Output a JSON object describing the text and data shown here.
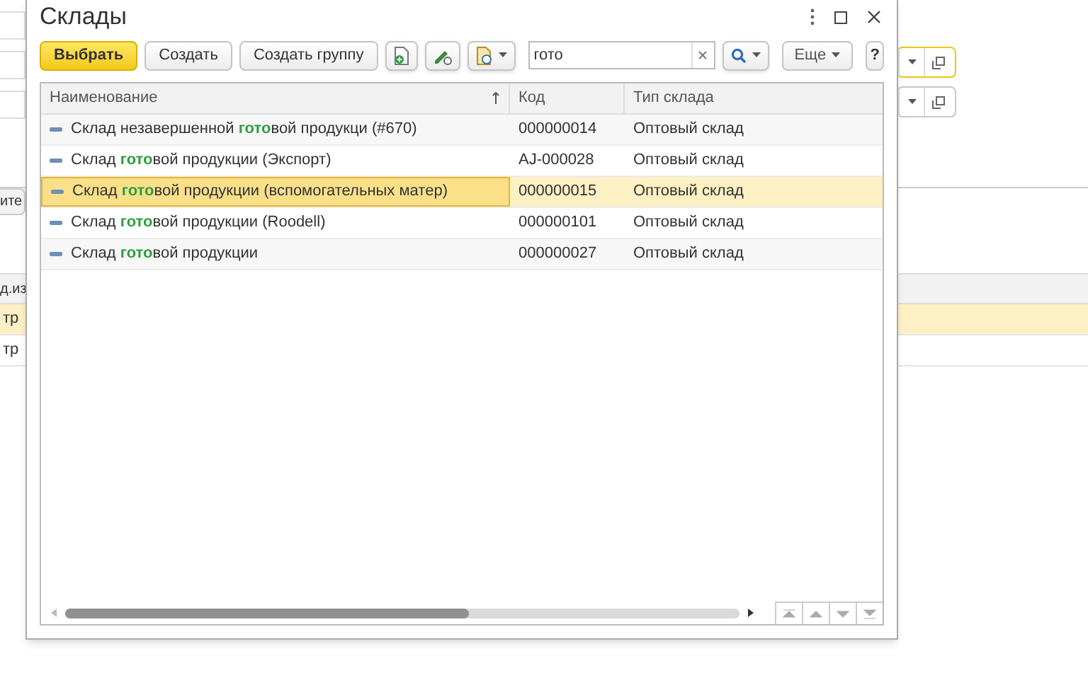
{
  "background": {
    "tab_label": "ите",
    "column_header": "д.из",
    "rows": [
      {
        "unit": "тр",
        "selected": true
      },
      {
        "unit": "тр",
        "selected": false
      }
    ],
    "fields": [
      {
        "focused": true
      },
      {
        "focused": false
      }
    ]
  },
  "window": {
    "title": "Склады"
  },
  "toolbar": {
    "choose": "Выбрать",
    "create": "Создать",
    "create_group": "Создать группу",
    "search": {
      "value": "гото"
    },
    "more": "Еще",
    "help": "?"
  },
  "table": {
    "columns": [
      {
        "label": "Наименование",
        "sorted": true
      },
      {
        "label": "Код",
        "sorted": false
      },
      {
        "label": "Тип склада",
        "sorted": false
      }
    ],
    "rows": [
      {
        "name": "Склад незавершенной **гото**вой продукци (#670)",
        "code": "000000014",
        "type": "Оптовый склад",
        "selected": false
      },
      {
        "name": "Склад **гото**вой продукции (Экспорт)",
        "code": "AJ-000028",
        "type": "Оптовый склад",
        "selected": false
      },
      {
        "name": "Склад **гото**вой продукции (вспомогательных матер)",
        "code": "000000015",
        "type": "Оптовый склад",
        "selected": true
      },
      {
        "name": "Склад **гото**вой продукции (Roodell)",
        "code": "000000101",
        "type": "Оптовый склад",
        "selected": false
      },
      {
        "name": "Склад **гото**вой продукции",
        "code": "000000027",
        "type": "Оптовый склад",
        "selected": false
      }
    ]
  }
}
